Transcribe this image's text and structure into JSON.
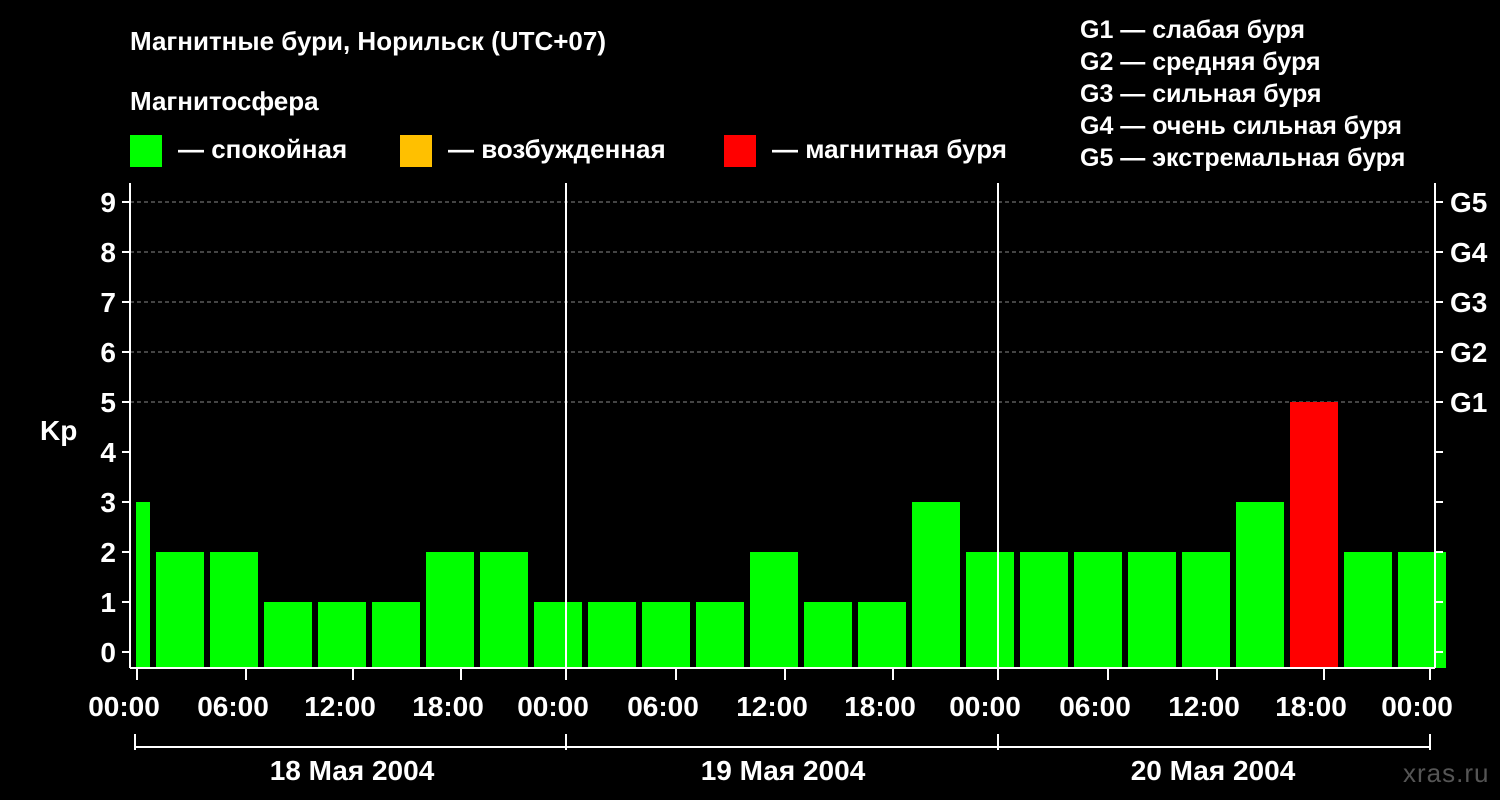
{
  "chart_data": {
    "type": "bar",
    "title": "Магнитные бури, Норильск (UTC+07)",
    "legend": {
      "title": "Магнитосфера",
      "items": [
        {
          "label": "— спокойная",
          "color": "#00ff00"
        },
        {
          "label": "— возбужденная",
          "color": "#ffc000"
        },
        {
          "label": "— магнитная буря",
          "color": "#ff0000"
        }
      ],
      "g_scale": [
        "G1 — слабая буря",
        "G2 — средняя буря",
        "G3 — сильная буря",
        "G4 — очень сильная буря",
        "G5 — экстремальная буря"
      ]
    },
    "ylabel": "Kp",
    "ylim": [
      0,
      9
    ],
    "yticks": [
      "0",
      "1",
      "2",
      "3",
      "4",
      "5",
      "6",
      "7",
      "8",
      "9"
    ],
    "g_ticks": [
      {
        "level": 5,
        "label": "G1"
      },
      {
        "level": 6,
        "label": "G2"
      },
      {
        "level": 7,
        "label": "G3"
      },
      {
        "level": 8,
        "label": "G4"
      },
      {
        "level": 9,
        "label": "G5"
      }
    ],
    "xticks": [
      "00:00",
      "06:00",
      "12:00",
      "18:00",
      "00:00",
      "06:00",
      "12:00",
      "18:00",
      "00:00",
      "06:00",
      "12:00",
      "18:00",
      "00:00"
    ],
    "days": [
      "18 Мая 2004",
      "19 Мая 2004",
      "20 Мая 2004"
    ],
    "interval_hours": 3,
    "series": [
      {
        "values": [
          3,
          2,
          2,
          1,
          1,
          1,
          2,
          2,
          1,
          1,
          1,
          1,
          2,
          1,
          1,
          3,
          2,
          2,
          2,
          2,
          2,
          3,
          5,
          2,
          2
        ],
        "colors": [
          "#00ff00",
          "#00ff00",
          "#00ff00",
          "#00ff00",
          "#00ff00",
          "#00ff00",
          "#00ff00",
          "#00ff00",
          "#00ff00",
          "#00ff00",
          "#00ff00",
          "#00ff00",
          "#00ff00",
          "#00ff00",
          "#00ff00",
          "#00ff00",
          "#00ff00",
          "#00ff00",
          "#00ff00",
          "#00ff00",
          "#00ff00",
          "#00ff00",
          "#ff0000",
          "#00ff00",
          "#00ff00"
        ]
      }
    ],
    "grid": true
  },
  "watermark": "xras.ru"
}
